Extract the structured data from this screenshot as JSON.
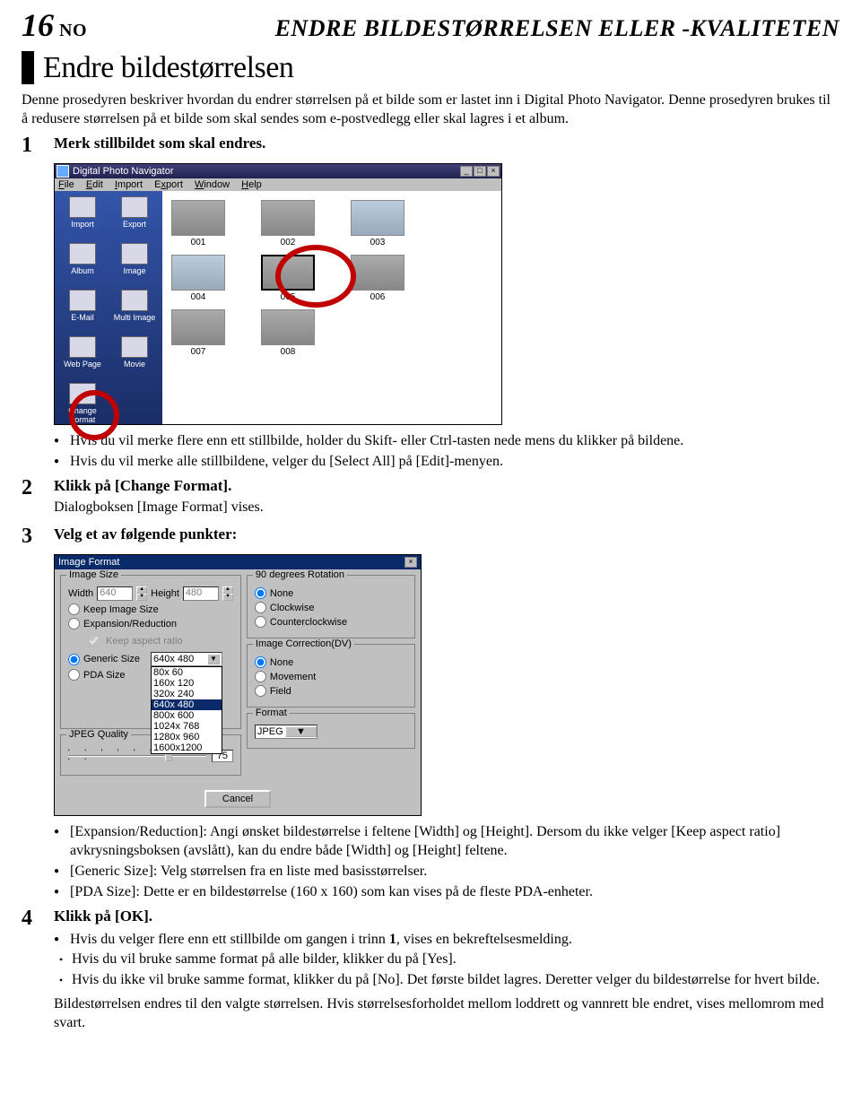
{
  "page": {
    "number": "16",
    "lang": "NO",
    "title_right": "ENDRE BILDESTØRRELSEN ELLER -KVALITETEN"
  },
  "section": {
    "heading": "Endre bildestørrelsen",
    "intro1": "Denne prosedyren beskriver hvordan du endrer størrelsen på et bilde som er lastet inn i Digital Photo Navigator. Denne prosedyren brukes til å redusere størrelsen på et bilde som skal sendes som e-postvedlegg eller skal lagres i et album."
  },
  "steps": {
    "s1": {
      "num": "1",
      "label": "Merk stillbildet som skal endres."
    },
    "s2": {
      "num": "2",
      "label": "Klikk på [Change Format].",
      "sub": "Dialogboksen [Image Format] vises."
    },
    "s3": {
      "num": "3",
      "label": "Velg et av følgende punkter:"
    },
    "s4": {
      "num": "4",
      "label": "Klikk på [OK]."
    }
  },
  "bullets_after_s1": {
    "b1": "Hvis du vil merke flere enn ett stillbilde, holder du Skift- eller Ctrl-tasten nede mens du klikker på bildene.",
    "b2": "Hvis du vil merke alle stillbildene, velger du [Select All] på [Edit]-menyen."
  },
  "bullets_after_s3": {
    "b1": "[Expansion/Reduction]: Angi ønsket bildestørrelse i feltene [Width] og [Height]. Dersom du ikke velger [Keep aspect ratio] avkrysningsboksen (avslått), kan du endre både [Width] og [Height] feltene.",
    "b2": "[Generic Size]: Velg størrelsen fra en liste med basisstørrelser.",
    "b3": "[PDA Size]: Dette er en bildestørrelse (160 x 160) som kan vises på de fleste PDA-enheter."
  },
  "bullets_after_s4": {
    "b1_prefix": "Hvis du velger flere enn ett stillbilde om gangen i trinn ",
    "b1_bold": "1",
    "b1_suffix": ", vises en bekreftelsesmelding.",
    "sb1": "Hvis du vil bruke samme format på alle bilder, klikker du på [Yes].",
    "sb2": "Hvis du ikke vil bruke samme format, klikker du på [No]. Det første bildet lagres. Deretter velger du bildestørrelse for hvert bilde.",
    "tail": "Bildestørrelsen endres til den valgte størrelsen. Hvis størrelsesforholdet mellom loddrett og vannrett ble endret, vises mellomrom med svart."
  },
  "app": {
    "title": "Digital Photo Navigator",
    "menus": {
      "file": "File",
      "edit": "Edit",
      "import": "Import",
      "export": "Export",
      "window": "Window",
      "help": "Help"
    },
    "sidebar": {
      "import": "Import",
      "export": "Export",
      "album": "Album",
      "image": "Image",
      "email": "E-Mail",
      "multi": "Multi Image",
      "web": "Web Page",
      "movie": "Movie",
      "change": "Change Format"
    },
    "thumbs": {
      "t1": "001",
      "t2": "002",
      "t3": "003",
      "t4": "004",
      "t5": "005",
      "t6": "006",
      "t7": "007",
      "t8": "008"
    }
  },
  "dialog": {
    "title": "Image Format",
    "groups": {
      "size": "Image Size",
      "rotation": "90 degrees Rotation",
      "correction": "Image Correction(DV)",
      "quality": "JPEG Quality",
      "format": "Format"
    },
    "size": {
      "width_lbl": "Width",
      "width_val": "640",
      "height_lbl": "Height",
      "height_val": "480",
      "keep": "Keep Image Size",
      "expred": "Expansion/Reduction",
      "aspect": "Keep aspect ratio",
      "generic": "Generic Size",
      "pda": "PDA Size",
      "generic_sel": "640x 480",
      "opts": [
        "80x 60",
        "160x 120",
        "320x 240",
        "640x 480",
        "800x 600",
        "1024x 768",
        "1280x 960",
        "1600x1200"
      ]
    },
    "rotation": {
      "none": "None",
      "cw": "Clockwise",
      "ccw": "Counterclockwise"
    },
    "correction": {
      "none": "None",
      "movement": "Movement",
      "field": "Field"
    },
    "quality": {
      "value": "75"
    },
    "format": {
      "value": "JPEG"
    },
    "buttons": {
      "cancel": "Cancel"
    }
  }
}
